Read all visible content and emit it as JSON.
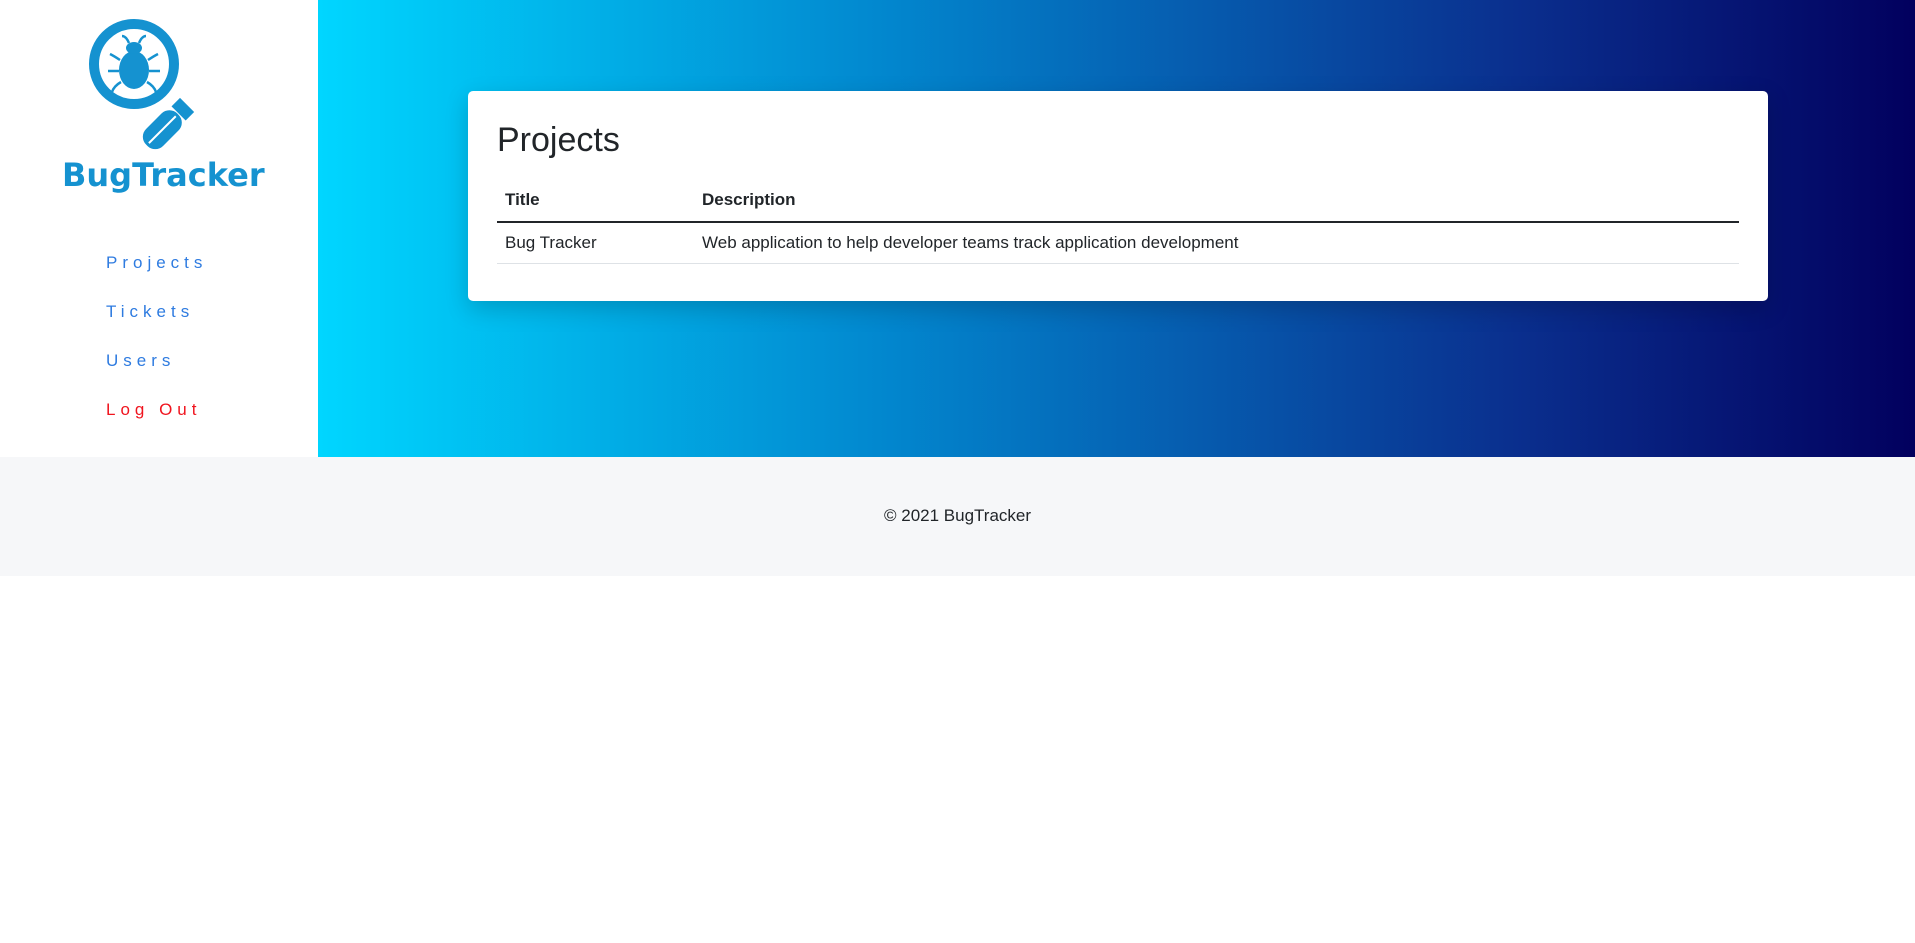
{
  "brand": {
    "name": "BugTracker",
    "logo_icon": "bug-magnifier-icon",
    "color": "#1592d0"
  },
  "nav": {
    "items": [
      {
        "label": "Projects",
        "color": "#2e7be0"
      },
      {
        "label": "Tickets",
        "color": "#2e7be0"
      },
      {
        "label": "Users",
        "color": "#2e7be0"
      },
      {
        "label": "Log Out",
        "color": "#f0141e"
      }
    ]
  },
  "main": {
    "title": "Projects",
    "table": {
      "headers": [
        "Title",
        "Description"
      ],
      "rows": [
        [
          "Bug Tracker",
          "Web application to help developer teams track application development"
        ]
      ]
    },
    "gradient": [
      "#00d6ff",
      "#02005e"
    ]
  },
  "footer": {
    "copyright": "© 2021 BugTracker"
  }
}
